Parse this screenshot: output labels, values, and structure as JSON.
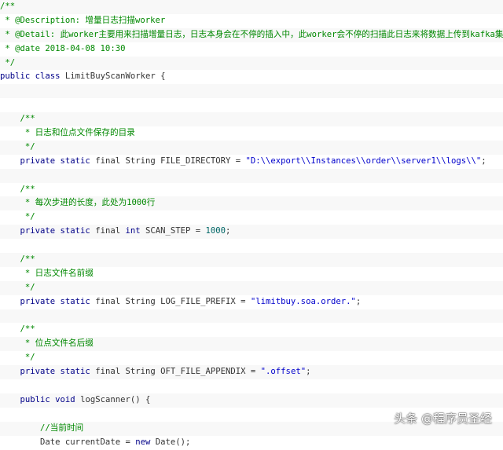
{
  "code": {
    "lines": [
      [
        [
          "cm",
          "/**"
        ]
      ],
      [
        [
          "cm",
          " * @Description: 增量日志扫描worker"
        ]
      ],
      [
        [
          "cm",
          " * @Detail: 此worker主要用来扫描增量日志，日志本身会在不停的插入中，此worker会不停的扫描此日志来将数据上传到kafka集群"
        ]
      ],
      [
        [
          "cm",
          " * @date 2018-04-08 10:30"
        ]
      ],
      [
        [
          "cm",
          " */"
        ]
      ],
      [
        [
          "kw",
          "public class "
        ],
        [
          "pl",
          "LimitBuyScanWorker {"
        ]
      ],
      [],
      [],
      [
        [
          "cm",
          "    /**"
        ]
      ],
      [
        [
          "cm",
          "     * 日志和位点文件保存的目录"
        ]
      ],
      [
        [
          "cm",
          "     */"
        ]
      ],
      [
        [
          "kw",
          "    private static "
        ],
        [
          "pl",
          "final String FILE_DIRECTORY = "
        ],
        [
          "str",
          "\"D:\\\\export\\\\Instances\\\\order\\\\server1\\\\logs\\\\\""
        ],
        [
          "pl",
          ";"
        ]
      ],
      [],
      [
        [
          "cm",
          "    /**"
        ]
      ],
      [
        [
          "cm",
          "     * 每次步进的长度，此处为1000行"
        ]
      ],
      [
        [
          "cm",
          "     */"
        ]
      ],
      [
        [
          "kw",
          "    private static "
        ],
        [
          "pl",
          "final "
        ],
        [
          "kw",
          "int "
        ],
        [
          "pl",
          "SCAN_STEP = "
        ],
        [
          "num",
          "1000"
        ],
        [
          "pl",
          ";"
        ]
      ],
      [],
      [
        [
          "cm",
          "    /**"
        ]
      ],
      [
        [
          "cm",
          "     * 日志文件名前缀"
        ]
      ],
      [
        [
          "cm",
          "     */"
        ]
      ],
      [
        [
          "kw",
          "    private static "
        ],
        [
          "pl",
          "final String LOG_FILE_PREFIX = "
        ],
        [
          "str",
          "\"limitbuy.soa.order.\""
        ],
        [
          "pl",
          ";"
        ]
      ],
      [],
      [
        [
          "cm",
          "    /**"
        ]
      ],
      [
        [
          "cm",
          "     * 位点文件名后缀"
        ]
      ],
      [
        [
          "cm",
          "     */"
        ]
      ],
      [
        [
          "kw",
          "    private static "
        ],
        [
          "pl",
          "final String OFT_FILE_APPENDIX = "
        ],
        [
          "str",
          "\".offset\""
        ],
        [
          "pl",
          ";"
        ]
      ],
      [],
      [
        [
          "kw",
          "    public void "
        ],
        [
          "pl",
          "logScanner() {"
        ]
      ],
      [],
      [
        [
          "cm",
          "        //当前时间"
        ]
      ],
      [
        [
          "pl",
          "        Date currentDate = "
        ],
        [
          "kw",
          "new "
        ],
        [
          "pl",
          "Date();"
        ]
      ]
    ]
  },
  "watermark": "头条 @程序员圣经"
}
